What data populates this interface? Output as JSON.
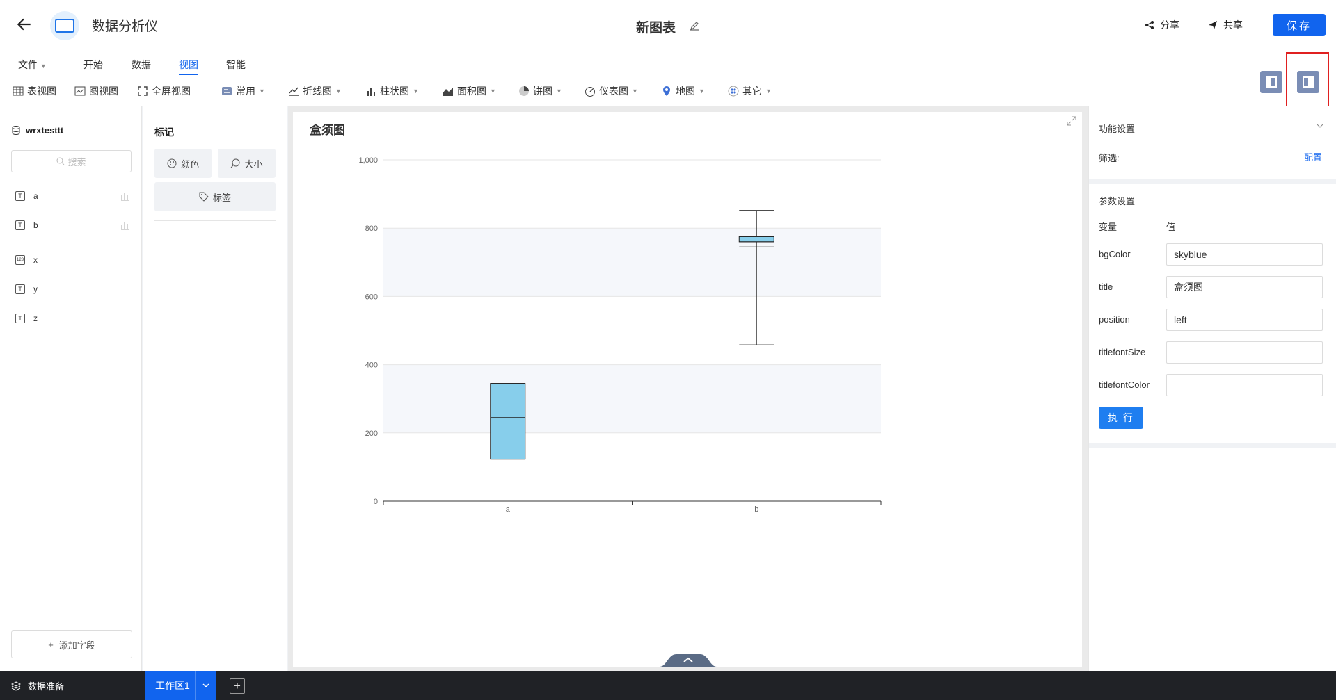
{
  "header": {
    "app_name": "数据分析仪",
    "doc_title": "新图表",
    "share_label": "分享",
    "collab_label": "共享",
    "save_label": "保存"
  },
  "menu": {
    "items": [
      "文件",
      "开始",
      "数据",
      "视图",
      "智能"
    ],
    "active": "视图"
  },
  "toolbar": {
    "views": [
      "表视图",
      "图视图",
      "全屏视图"
    ],
    "chart_types": [
      "常用",
      "折线图",
      "柱状图",
      "面积图",
      "饼图",
      "仪表图",
      "地图",
      "其它"
    ]
  },
  "field_panel": {
    "datasource": "wrxtesttt",
    "search_placeholder": "搜索",
    "fields": [
      {
        "name": "a",
        "type": "T",
        "measure": true
      },
      {
        "name": "b",
        "type": "T",
        "measure": true
      },
      {
        "name": "x",
        "type": "123",
        "measure": false
      },
      {
        "name": "y",
        "type": "T",
        "measure": false
      },
      {
        "name": "z",
        "type": "T",
        "measure": false
      }
    ],
    "add_field_label": "添加字段"
  },
  "marks": {
    "title": "标记",
    "color_label": "颜色",
    "size_label": "大小",
    "label_label": "标签"
  },
  "chart_data": {
    "type": "boxplot",
    "title": "盒须图",
    "categories": [
      "a",
      "b"
    ],
    "ylim": [
      0,
      1000
    ],
    "yticks": [
      "0",
      "200",
      "400",
      "600",
      "800",
      "1,000"
    ],
    "boxes": [
      {
        "category": "a",
        "min": 123,
        "q1": 123,
        "median": 245,
        "q3": 345,
        "max": 345
      },
      {
        "category": "b",
        "min": 458,
        "q1": 760,
        "median": 760,
        "q3": 775,
        "max": 852,
        "lower_inner": 745
      }
    ],
    "fill_color": "#87ceeb",
    "band_color": "#f5f7fb"
  },
  "settings": {
    "function_title": "功能设置",
    "filter_label": "筛选:",
    "filter_link": "配置",
    "param_title": "参数设置",
    "col_var": "变量",
    "col_val": "值",
    "params": [
      {
        "name": "bgColor",
        "value": "skyblue"
      },
      {
        "name": "title",
        "value": "盒须图"
      },
      {
        "name": "position",
        "value": "left"
      },
      {
        "name": "titlefontSize",
        "value": ""
      },
      {
        "name": "titlefontColor",
        "value": ""
      }
    ],
    "exec_label": "执 行"
  },
  "bottom": {
    "prep_label": "数据准备",
    "workspace_tab": "工作区1"
  },
  "colors": {
    "accent": "#1164ee",
    "layout_btn": "#7a8db5",
    "highlight": "#e02020"
  }
}
